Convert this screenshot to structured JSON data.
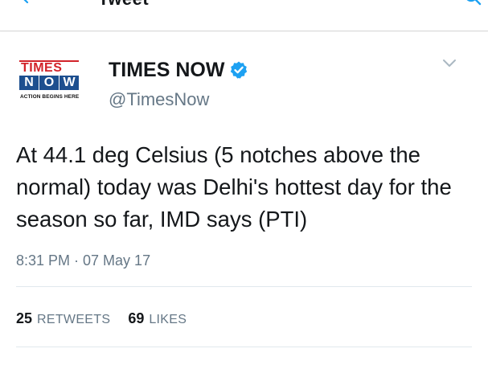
{
  "nav": {
    "title": "Tweet",
    "back_icon": "back-arrow-icon",
    "search_icon": "search-icon"
  },
  "author": {
    "display_name": "TIMES NOW",
    "handle": "@TimesNow",
    "verified_icon": "verified-badge-icon",
    "avatar": {
      "line1": "TIMES",
      "line2": [
        "N",
        "O",
        "W"
      ],
      "tagline": "ACTION BEGINS HERE"
    }
  },
  "tweet": {
    "text": "At 44.1 deg Celsius (5 notches above the normal) today was Delhi's hottest day for the season so far, IMD says (PTI)",
    "timestamp": "8:31 PM · 07 May 17"
  },
  "stats": {
    "retweets_count": "25",
    "retweets_label": "RETWEETS",
    "likes_count": "69",
    "likes_label": "LIKES"
  },
  "colors": {
    "accent": "#1da1f2",
    "text_primary": "#14171a",
    "text_secondary": "#657786",
    "divider": "#e1e8ed",
    "logo_red": "#d2232a",
    "logo_blue": "#1d4f8f"
  }
}
